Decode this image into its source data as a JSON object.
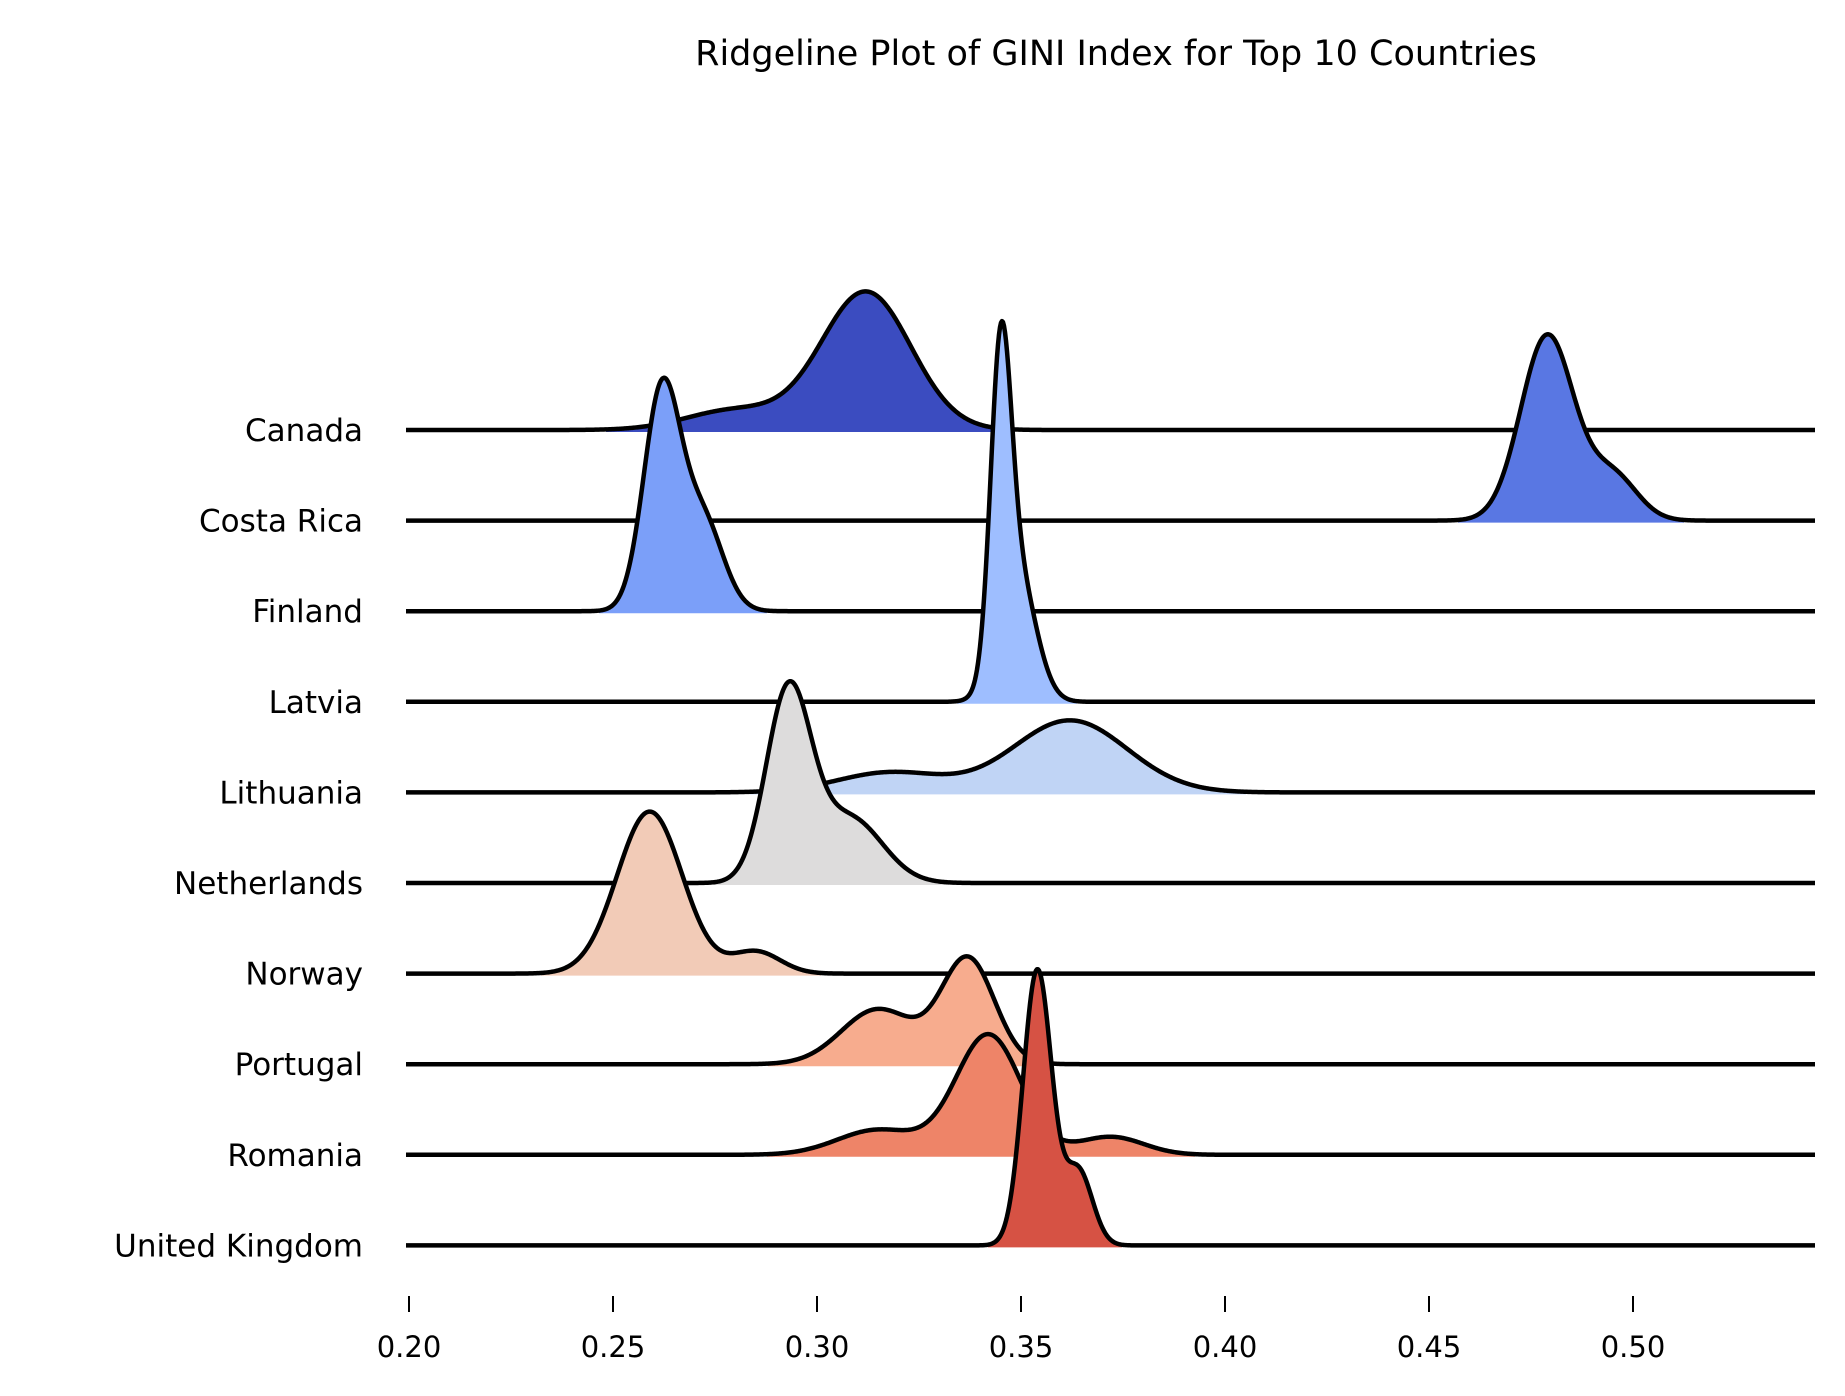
{
  "chart_data": {
    "type": "ridgeline",
    "title": "Ridgeline Plot of GINI Index for Top 10 Countries",
    "xlabel": "",
    "ylabel": "",
    "xlim": [
      0.2,
      0.545
    ],
    "xticks": [
      0.2,
      0.25,
      0.3,
      0.35,
      0.4,
      0.45,
      0.5
    ],
    "xtick_labels": [
      "0.20",
      "0.25",
      "0.30",
      "0.35",
      "0.40",
      "0.45",
      "0.50"
    ],
    "grid": false,
    "legend": "none",
    "colormap": "coolwarm",
    "series": [
      {
        "name": "Canada",
        "color": "#3b4cc0",
        "peak": 0.312,
        "components": [
          [
            0.312,
            0.011,
            1.38
          ],
          [
            0.28,
            0.012,
            0.2
          ]
        ]
      },
      {
        "name": "Costa Rica",
        "color": "#5977e3",
        "peak": 0.479,
        "components": [
          [
            0.479,
            0.0065,
            1.85
          ],
          [
            0.495,
            0.006,
            0.45
          ]
        ]
      },
      {
        "name": "Finland",
        "color": "#7b9ff9",
        "peak": 0.262,
        "components": [
          [
            0.262,
            0.0045,
            2.2
          ],
          [
            0.272,
            0.005,
            0.9
          ]
        ]
      },
      {
        "name": "Latvia",
        "color": "#9ebeff",
        "peak": 0.345,
        "components": [
          [
            0.345,
            0.0025,
            2.9
          ],
          [
            0.349,
            0.0045,
            1.3
          ]
        ]
      },
      {
        "name": "Lithuania",
        "color": "#c0d4f5",
        "peak": 0.362,
        "components": [
          [
            0.362,
            0.014,
            0.72
          ],
          [
            0.318,
            0.013,
            0.2
          ]
        ]
      },
      {
        "name": "Netherlands",
        "color": "#dddcdc",
        "peak": 0.293,
        "components": [
          [
            0.293,
            0.0055,
            1.9
          ],
          [
            0.308,
            0.008,
            0.65
          ]
        ]
      },
      {
        "name": "Norway",
        "color": "#f2cbb7",
        "peak": 0.259,
        "components": [
          [
            0.259,
            0.008,
            1.62
          ],
          [
            0.285,
            0.006,
            0.22
          ]
        ]
      },
      {
        "name": "Portugal",
        "color": "#f7ac8e",
        "peak": 0.337,
        "components": [
          [
            0.337,
            0.0065,
            1.05
          ],
          [
            0.315,
            0.009,
            0.55
          ]
        ]
      },
      {
        "name": "Romania",
        "color": "#ee8468",
        "peak": 0.342,
        "components": [
          [
            0.342,
            0.008,
            1.2
          ],
          [
            0.315,
            0.01,
            0.25
          ],
          [
            0.372,
            0.008,
            0.18
          ]
        ]
      },
      {
        "name": "United Kingdom",
        "color": "#d65244",
        "peak": 0.354,
        "components": [
          [
            0.354,
            0.0035,
            2.75
          ],
          [
            0.364,
            0.0035,
            0.75
          ]
        ]
      }
    ]
  }
}
